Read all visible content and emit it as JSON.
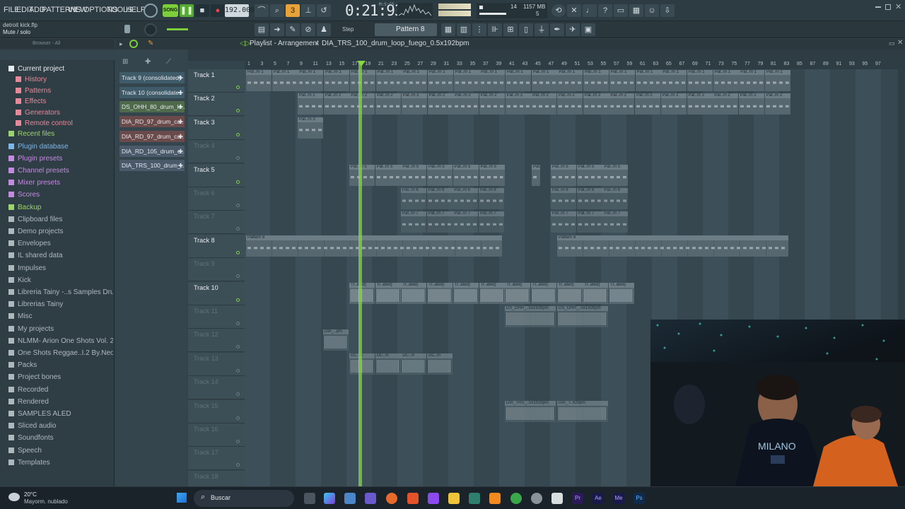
{
  "menu": [
    "FILE",
    "EDIT",
    "ADD",
    "PATTERNS",
    "VIEW",
    "OPTIONS",
    "TOOLS",
    "HELP"
  ],
  "transport": {
    "song_mode": "SONG",
    "tempo": "192.000",
    "time": "0:21:93",
    "time_unit": "M:S:CS",
    "cpu_val": "14",
    "mem": "1157 MB",
    "mem2": "5"
  },
  "hint": {
    "file": "detroit kick.flp",
    "text": "Mute / solo"
  },
  "snap": {
    "mode": "Step",
    "pattern": "Pattern 8"
  },
  "browser": {
    "header": "Browser - All",
    "items": [
      {
        "label": "Current project",
        "color": "#e6ebee",
        "indent": 0
      },
      {
        "label": "History",
        "color": "#e58a9a",
        "indent": 1
      },
      {
        "label": "Patterns",
        "color": "#e58a9a",
        "indent": 1
      },
      {
        "label": "Effects",
        "color": "#e58a9a",
        "indent": 1
      },
      {
        "label": "Generators",
        "color": "#e58a9a",
        "indent": 1
      },
      {
        "label": "Remote control",
        "color": "#e58a9a",
        "indent": 1
      },
      {
        "label": "Recent files",
        "color": "#9ad46a",
        "indent": 0
      },
      {
        "label": "Plugin database",
        "color": "#7db5e6",
        "indent": 0
      },
      {
        "label": "Plugin presets",
        "color": "#c38be0",
        "indent": 0
      },
      {
        "label": "Channel presets",
        "color": "#c38be0",
        "indent": 0
      },
      {
        "label": "Mixer presets",
        "color": "#c38be0",
        "indent": 0
      },
      {
        "label": "Scores",
        "color": "#c38be0",
        "indent": 0
      },
      {
        "label": "Backup",
        "color": "#9ad46a",
        "indent": 0
      },
      {
        "label": "Clipboard files",
        "color": "#aeb9be",
        "indent": 0
      },
      {
        "label": "Demo projects",
        "color": "#aeb9be",
        "indent": 0
      },
      {
        "label": "Envelopes",
        "color": "#aeb9be",
        "indent": 0
      },
      {
        "label": "IL shared data",
        "color": "#aeb9be",
        "indent": 0
      },
      {
        "label": "Impulses",
        "color": "#aeb9be",
        "indent": 0
      },
      {
        "label": "Kick",
        "color": "#aeb9be",
        "indent": 0
      },
      {
        "label": "Libreria Tainy -..s Samples Drum Kit",
        "color": "#aeb9be",
        "indent": 0
      },
      {
        "label": "Librerias Tainy",
        "color": "#aeb9be",
        "indent": 0
      },
      {
        "label": "Misc",
        "color": "#aeb9be",
        "indent": 0
      },
      {
        "label": "My projects",
        "color": "#aeb9be",
        "indent": 0
      },
      {
        "label": "NLMM- Arion One Shots Vol. 2",
        "color": "#aeb9be",
        "indent": 0
      },
      {
        "label": "One Shots Reggae..I.2 By.Neo Beats",
        "color": "#aeb9be",
        "indent": 0
      },
      {
        "label": "Packs",
        "color": "#aeb9be",
        "indent": 0
      },
      {
        "label": "Project bones",
        "color": "#aeb9be",
        "indent": 0
      },
      {
        "label": "Recorded",
        "color": "#aeb9be",
        "indent": 0
      },
      {
        "label": "Rendered",
        "color": "#aeb9be",
        "indent": 0
      },
      {
        "label": "SAMPLES ALED",
        "color": "#aeb9be",
        "indent": 0
      },
      {
        "label": "Sliced audio",
        "color": "#aeb9be",
        "indent": 0
      },
      {
        "label": "Soundfonts",
        "color": "#aeb9be",
        "indent": 0
      },
      {
        "label": "Speech",
        "color": "#aeb9be",
        "indent": 0
      },
      {
        "label": "Templates",
        "color": "#aeb9be",
        "indent": 0
      }
    ]
  },
  "playlist": {
    "title": "Playlist - Arrangement",
    "clip_name": "DIA_TRS_100_drum_loop_fuego_0.5x192bpm",
    "channels": [
      {
        "label": "Track 9 (consolidated)",
        "color": "#3f5a68"
      },
      {
        "label": "Track 10 (consolidate..",
        "color": "#3f5a68"
      },
      {
        "label": "DS_OHH_80_drum_lo..",
        "color": "#4f6a4a"
      },
      {
        "label": "DIA_RD_97_drum_ca..",
        "color": "#6a4a4a"
      },
      {
        "label": "DIA_RD_97_drum_ca..",
        "color": "#6a4a4a"
      },
      {
        "label": "DIA_RD_105_drum_c..",
        "color": "#4a5a6a"
      },
      {
        "label": "DIA_TRS_100_drum_..",
        "color": "#4a5a6a"
      }
    ],
    "tracks": [
      "Track 1",
      "Track 2",
      "Track 3",
      "Track 4",
      "Track 5",
      "Track 6",
      "Track 7",
      "Track 8",
      "Track 9",
      "Track 10",
      "Track 11",
      "Track 12",
      "Track 13",
      "Track 14",
      "Track 15",
      "Track 16",
      "Track 17",
      "Track 18"
    ],
    "ruler": [
      "1",
      "3",
      "5",
      "7",
      "9",
      "11",
      "13",
      "15",
      "17",
      "19",
      "21",
      "23",
      "25",
      "27",
      "29",
      "31",
      "33",
      "35",
      "37",
      "39",
      "41",
      "43",
      "45",
      "47",
      "49",
      "51",
      "53",
      "55",
      "57",
      "59",
      "61",
      "63",
      "65",
      "67",
      "69",
      "71",
      "73",
      "75",
      "77",
      "79",
      "81",
      "83",
      "85",
      "87",
      "89",
      "91",
      "93",
      "95",
      "97"
    ],
    "clips": {
      "pat1": "Pat..rn 1",
      "pat2": "Pat..rn 2",
      "pat3": "Pat..rn 3",
      "pat5": "Pat..rn 5",
      "pat6": "Pat..rn 6",
      "pat7": "Pat..rn 7",
      "pat8": "Pattern 8",
      "tr": "Tr..ated)",
      "ohh": "DS_OHH_..5x192bpm",
      "dia": "DIA_..pm",
      "dc": "DC..m",
      "trs1": "DIA_TRS_..5x192bpm",
      "trs2": "DIA_T..92bpm"
    }
  },
  "taskbar": {
    "temp": "20°C",
    "weather": "Mayorm. nublado",
    "search": "Buscar"
  }
}
